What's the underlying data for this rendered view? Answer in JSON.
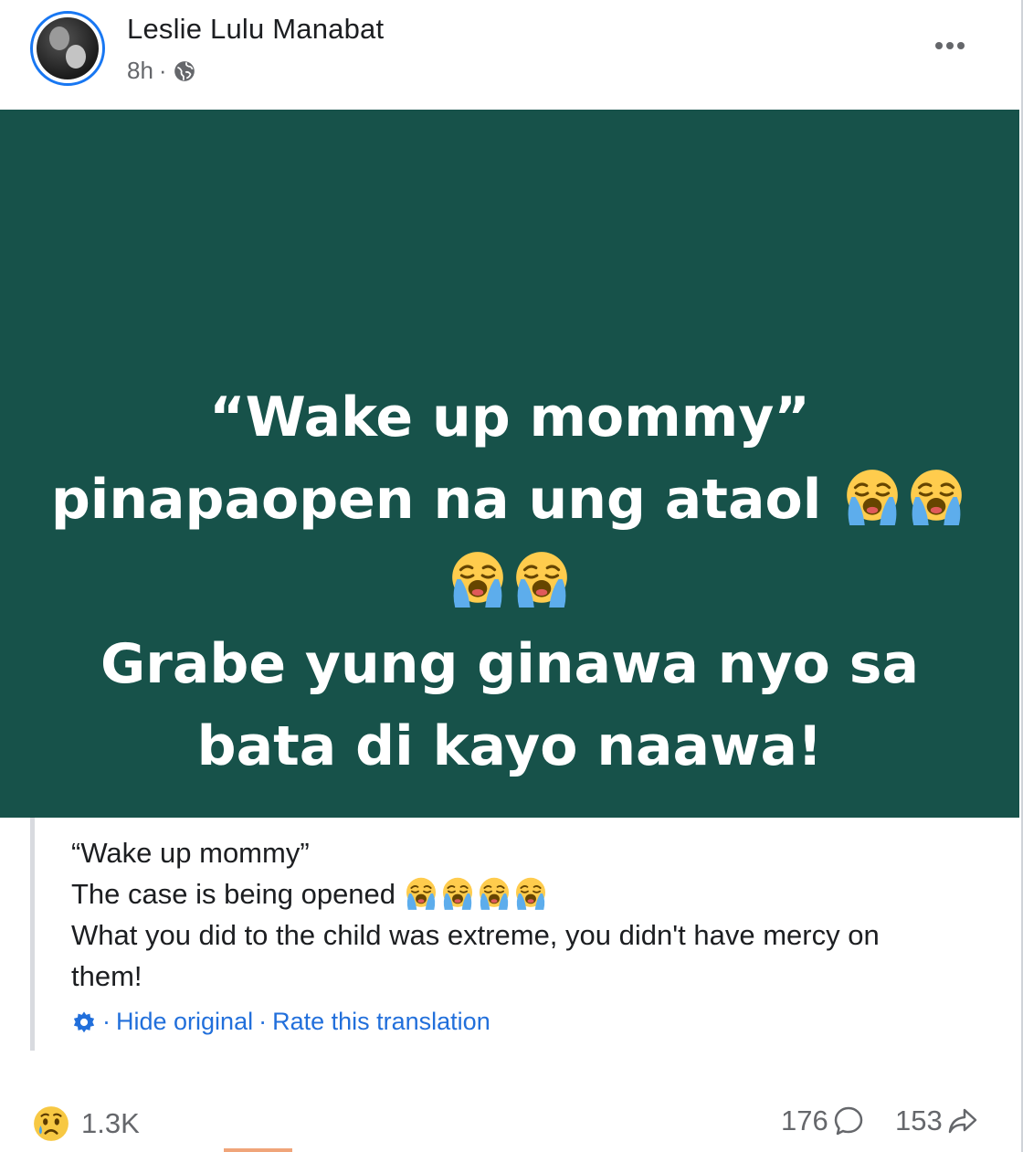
{
  "post": {
    "author": "Leslie Lulu Manabat",
    "time": "8h",
    "meta_separator": "·",
    "privacy_icon": "globe-icon",
    "more_icon": "more-horizontal-icon"
  },
  "card": {
    "background": "#17524a",
    "line1": "“Wake up mommy”",
    "line2": "pinapaopen na ung ataol",
    "line3": "Grabe yung ginawa nyo sa",
    "line4": "bata di kayo naawa!",
    "emoji_icon": "loudly-crying-face-icon"
  },
  "translation": {
    "line1": "“Wake up mommy”",
    "line2": "The case is being opened",
    "line3": "What you did to the child was extreme, you didn't have mercy on",
    "line4": "them!",
    "settings_icon": "gear-icon",
    "sep": "·",
    "hide_original": "Hide original",
    "rate_translation": "Rate this translation"
  },
  "footer": {
    "reaction_icon": "sad-face-icon",
    "reaction_count": "1.3K",
    "comment_count": "176",
    "share_count": "153"
  },
  "colors": {
    "card_bg": "#17524a",
    "link": "#216fdb",
    "avatar_ring": "#1877f2",
    "muted_text": "#65676b"
  }
}
